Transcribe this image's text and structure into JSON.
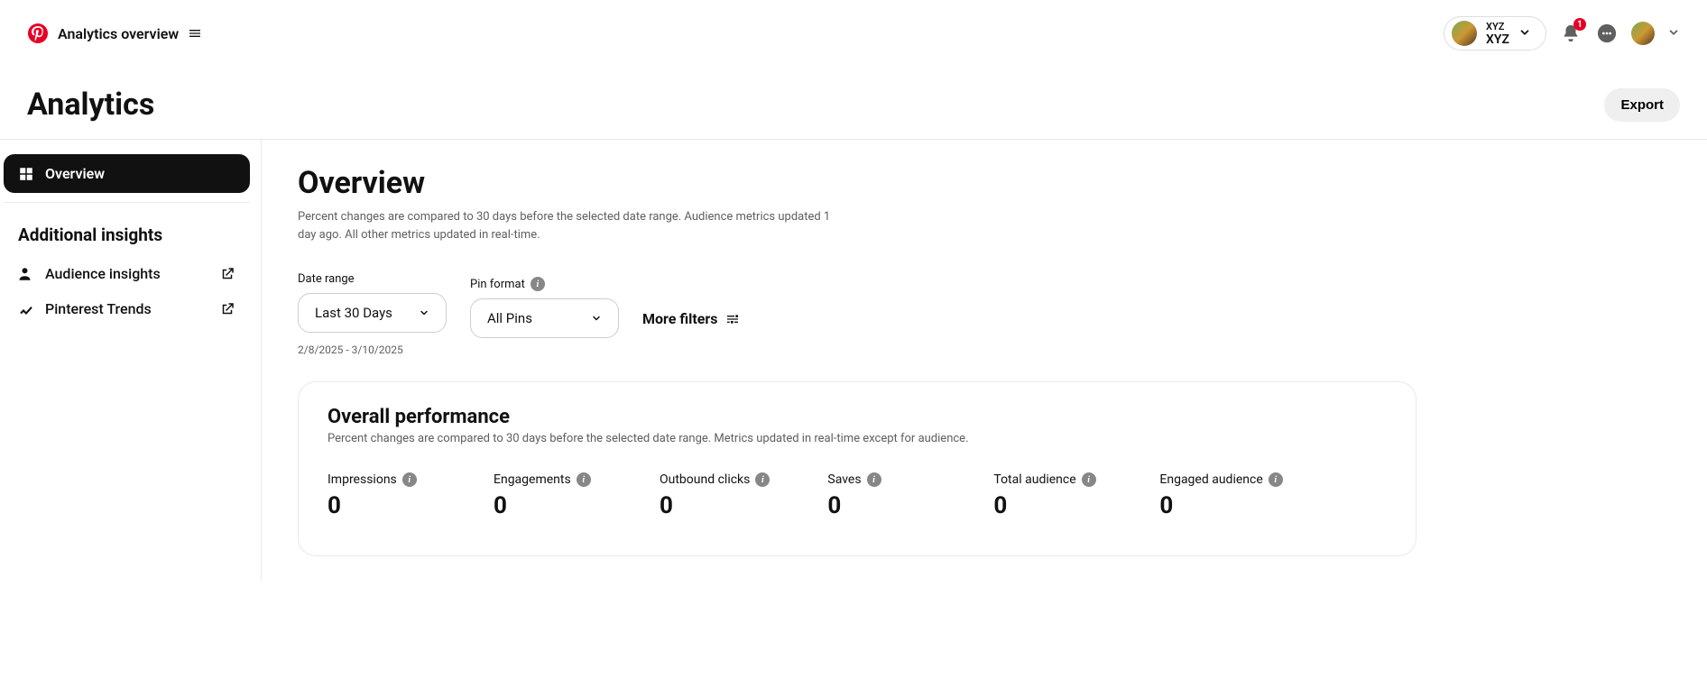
{
  "topbar": {
    "title": "Analytics overview",
    "account": {
      "line1": "XYZ",
      "line2": "XYZ"
    },
    "notification_badge": "1"
  },
  "page": {
    "title": "Analytics",
    "export_label": "Export"
  },
  "sidebar": {
    "overview_label": "Overview",
    "section_title": "Additional insights",
    "links": [
      {
        "label": "Audience insights"
      },
      {
        "label": "Pinterest Trends"
      }
    ]
  },
  "overview": {
    "heading": "Overview",
    "subtext": "Percent changes are compared to 30 days before the selected date range. Audience metrics updated 1 day ago. All other metrics updated in real-time."
  },
  "filters": {
    "date_range_label": "Date range",
    "date_range_value": "Last 30 Days",
    "date_range_sub": "2/8/2025 - 3/10/2025",
    "pin_format_label": "Pin format",
    "pin_format_value": "All Pins",
    "more_filters_label": "More filters"
  },
  "performance": {
    "title": "Overall performance",
    "subtext": "Percent changes are compared to 30 days before the selected date range. Metrics updated in real-time except for audience.",
    "metrics": [
      {
        "label": "Impressions",
        "value": "0"
      },
      {
        "label": "Engagements",
        "value": "0"
      },
      {
        "label": "Outbound clicks",
        "value": "0"
      },
      {
        "label": "Saves",
        "value": "0"
      },
      {
        "label": "Total audience",
        "value": "0"
      },
      {
        "label": "Engaged audience",
        "value": "0"
      }
    ]
  }
}
